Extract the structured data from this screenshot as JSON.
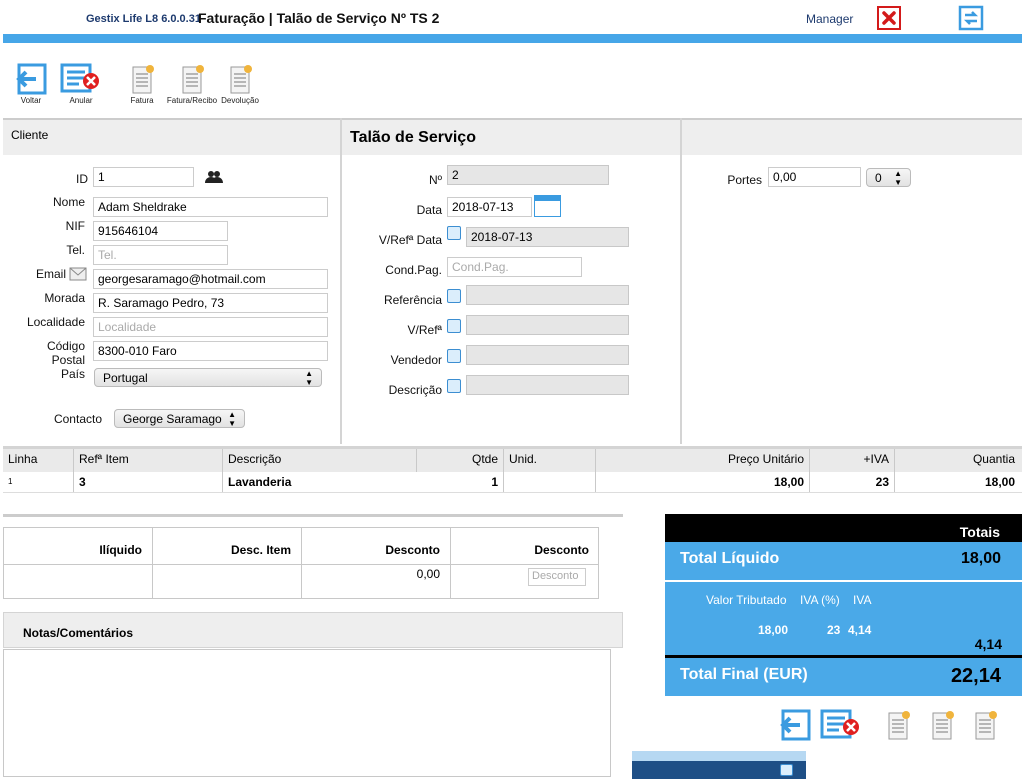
{
  "header": {
    "app": "Gestix Life L8 6.0.0.31",
    "title": "Faturação | Talão de Serviço Nº TS 2",
    "user": "Manager"
  },
  "toolbar": {
    "voltar": "Voltar",
    "anular": "Anular",
    "fatura": "Fatura",
    "fatura_recibo": "Fatura/Recibo",
    "devolucao": "Devolução"
  },
  "cliente": {
    "section": "Cliente",
    "id_label": "ID",
    "id": "1",
    "nome_label": "Nome",
    "nome": "Adam Sheldrake",
    "nif_label": "NIF",
    "nif": "915646104",
    "tel_label": "Tel.",
    "tel_ph": "Tel.",
    "email_label": "Email",
    "email": "georgesaramago@hotmail.com",
    "morada_label": "Morada",
    "morada": "R. Saramago Pedro, 73",
    "localidade_label": "Localidade",
    "localidade_ph": "Localidade",
    "cp_label1": "Código",
    "cp_label2": "Postal",
    "cp": "8300-010 Faro",
    "pais_label": "País",
    "pais": "Portugal",
    "contacto_label": "Contacto",
    "contacto": "George Saramago"
  },
  "talao": {
    "section": "Talão de Serviço",
    "n_label": "Nº",
    "n": "2",
    "data_label": "Data",
    "data": "2018-07-13",
    "vref_data_label": "V/Refª Data",
    "vref_data": "2018-07-13",
    "cond_label": "Cond.Pag.",
    "cond_ph": "Cond.Pag.",
    "ref_label": "Referência",
    "vref_label": "V/Refª",
    "vendedor_label": "Vendedor",
    "descricao_label": "Descrição"
  },
  "portes": {
    "label": "Portes",
    "value": "0,00",
    "select": "0"
  },
  "lines": {
    "headers": [
      "Linha",
      "Refª Item",
      "Descrição",
      "Qtde",
      "Unid.",
      "Preço Unitário",
      "+IVA",
      "Quantia"
    ],
    "rows": [
      [
        "1",
        "3",
        "Lavanderia",
        "1",
        "",
        "18,00",
        "23",
        "18,00"
      ]
    ]
  },
  "summary": {
    "headers": [
      "Ilíquido",
      "Desc. Item",
      "Desconto",
      "Desconto"
    ],
    "desconto_val": "0,00",
    "desconto_ph": "Desconto"
  },
  "notas": {
    "label": "Notas/Comentários"
  },
  "totais": {
    "title": "Totais",
    "liquido_label": "Total Líquido",
    "liquido": "18,00",
    "vt_label": "Valor Tributado",
    "iva_pct_label": "IVA (%)",
    "iva_label": "IVA",
    "vt": "18,00",
    "iva_pct": "23",
    "iva": "4,14",
    "iva_total": "4,14",
    "final_label": "Total Final (EUR)",
    "final": "22,14"
  }
}
